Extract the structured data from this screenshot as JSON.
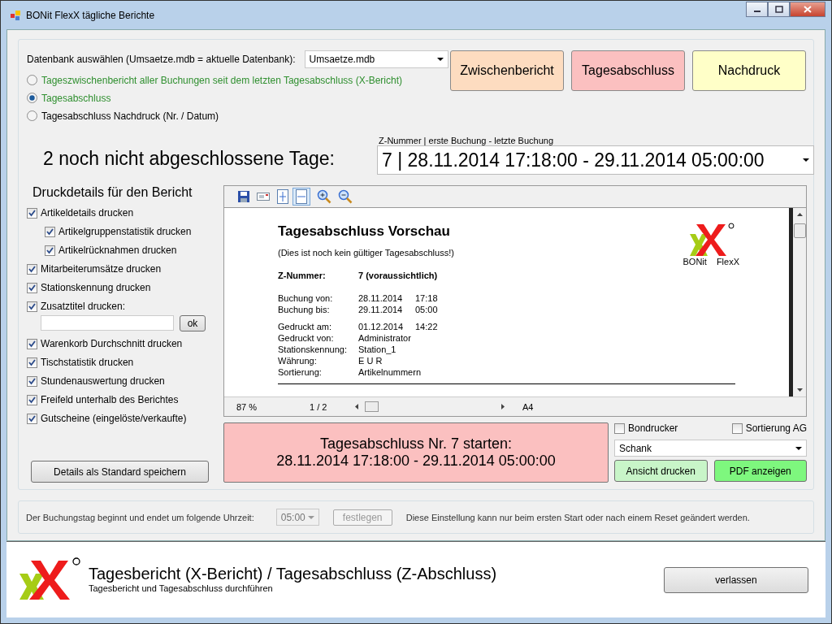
{
  "window": {
    "title": "BONit FlexX tägliche Berichte"
  },
  "database": {
    "label": "Datenbank auswählen (Umsaetze.mdb = aktuelle Datenbank):",
    "value": "Umsaetze.mdb"
  },
  "report_types": [
    {
      "label": "Tageszwischenbericht aller Buchungen seit dem letzten Tagesabschluss (X-Bericht)",
      "selected": false,
      "color": "#2f8f2f"
    },
    {
      "label": "Tagesabschluss",
      "selected": true,
      "color": "#2f8f2f"
    },
    {
      "label": "Tagesabschluss Nachdruck (Nr. / Datum)",
      "selected": false,
      "color": "#000000"
    }
  ],
  "action_buttons": [
    {
      "label": "Zwischenbericht",
      "color": "#fddcc0"
    },
    {
      "label": "Tagesabschluss",
      "color": "#fbc0c0"
    },
    {
      "label": "Nachdruck",
      "color": "#ffffc8"
    }
  ],
  "open_days": "2 noch nicht abgeschlossene Tage:",
  "z_select": {
    "label": "Z-Nummer | erste Buchung - letzte Buchung",
    "value": "7 | 28.11.2014 17:18:00 - 29.11.2014 05:00:00"
  },
  "details": {
    "title": "Druckdetails für den Bericht",
    "items": [
      {
        "kind": "checkbox",
        "label": "Artikeldetails drucken",
        "checked": true,
        "children": [
          {
            "kind": "checkbox",
            "label": "Artikelgruppenstatistik drucken",
            "checked": true
          },
          {
            "kind": "checkbox",
            "label": "Artikelrücknahmen drucken",
            "checked": true
          }
        ]
      },
      {
        "kind": "checkbox",
        "label": "Mitarbeiterumsätze drucken",
        "checked": true
      },
      {
        "kind": "checkbox",
        "label": "Stationskennung drucken",
        "checked": true
      },
      {
        "kind": "text_option",
        "label": "Zusatztitel drucken:",
        "checked": true,
        "button": "ok"
      },
      {
        "kind": "checkbox",
        "label": "Warenkorb Durchschnitt drucken",
        "checked": true
      },
      {
        "kind": "checkbox",
        "label": "Tischstatistik drucken",
        "checked": true
      },
      {
        "kind": "checkbox",
        "label": "Stundenauswertung drucken",
        "checked": true
      },
      {
        "kind": "checkbox",
        "label": "Freifeld unterhalb des Berichtes",
        "checked": true
      },
      {
        "kind": "checkbox",
        "label": "Gutscheine (eingelöste/verkaufte)",
        "checked": true
      }
    ],
    "save_button": "Details als Standard speichern"
  },
  "preview": {
    "document": {
      "title": "Tagesabschluss  Vorschau",
      "subtitle": "(Dies ist noch kein gültiger Tagesabschluss!)",
      "z_number": {
        "label": "Z-Nummer:",
        "value": "7 (voraussichtlich)"
      },
      "logo_words": [
        "BONit",
        "FlexX"
      ],
      "groups": [
        [
          {
            "label": "Buchung  von:",
            "value": "28.11.2014",
            "time": "17:18"
          },
          {
            "label": "Buchung  bis:",
            "value": "29.11.2014",
            "time": "05:00"
          }
        ],
        [
          {
            "label": "Gedruckt  am:",
            "value": "01.12.2014",
            "time": "14:22"
          },
          {
            "label": "Gedruckt  von:",
            "value": "Administrator"
          },
          {
            "label": "Stationskennung:",
            "value": "Station_1"
          },
          {
            "label": "Währung:",
            "value": "E U R"
          },
          {
            "label": "Sortierung:",
            "value": "Artikelnummern"
          }
        ]
      ]
    },
    "zoom": "87 %",
    "page": "1 / 2",
    "paper": "A4"
  },
  "start_button": [
    "Tagesabschluss Nr. 7 starten:",
    "28.11.2014 17:18:00 - 29.11.2014 05:00:00"
  ],
  "print_options": {
    "checkboxes": [
      {
        "label": "Bondrucker",
        "checked": false
      },
      {
        "label": "Sortierung AG",
        "checked": false
      }
    ],
    "printer": "Schank",
    "buttons": [
      {
        "label": "Ansicht drucken",
        "color": "#c8f5c8"
      },
      {
        "label": "PDF anzeigen",
        "color": "#7ef77e"
      }
    ]
  },
  "day_setting": {
    "label": "Der Buchungstag beginnt und endet um folgende Uhrzeit:",
    "time": "05:00",
    "time_disabled": true,
    "button": "festlegen",
    "button_disabled": true,
    "note": "Diese Einstellung kann nur beim ersten Start oder nach einem Reset geändert werden."
  },
  "footer": {
    "title": "Tagesbericht (X-Bericht) / Tagesabschluss (Z-Abschluss)",
    "subtitle": "Tagesbericht und Tagesabschluss durchführen",
    "exit_button": "verlassen"
  }
}
